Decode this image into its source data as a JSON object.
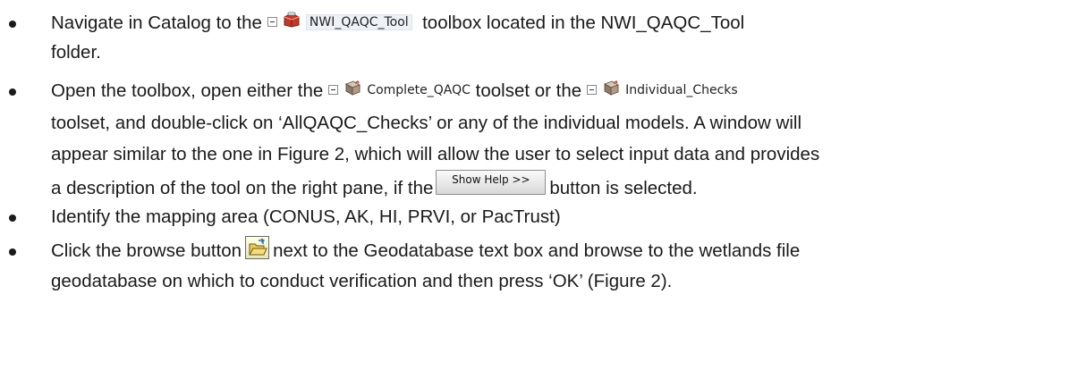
{
  "bullets": [
    {
      "line1": {
        "pre": "Navigate in Catalog to the",
        "icon": "toolbox-icon",
        "tool_label": "NWI_QAQC_Tool",
        "post": "toolbox located in the NWI_QAQC_Tool"
      },
      "line2": "folder."
    },
    {
      "line1": {
        "pre": "Open the toolbox, open either the",
        "icon1": "toolset-icon",
        "toolset1": "Complete_QAQC",
        "mid": "toolset or the",
        "icon2": "toolset-icon",
        "toolset2": "Individual_Checks"
      },
      "line2": "toolset, and double-click on ‘AllQAQC_Checks’ or any of the individual models. A window will",
      "line3": "appear similar to the one in Figure 2, which will allow the user to select input data and provides",
      "line4": {
        "pre": "a description of the tool on the right pane, if the",
        "button_label": "Show Help >>",
        "post": "button is selected."
      }
    },
    {
      "line1": "Identify the mapping area (CONUS, AK, HI, PRVI, or PacTrust)"
    },
    {
      "line1": {
        "pre": "Click the browse button",
        "icon": "open-folder-icon",
        "post": "next to the Geodatabase text box and browse to the wetlands file"
      },
      "line2": "geodatabase on which to conduct verification and then press ‘OK’ (Figure 2)."
    }
  ],
  "colors": {
    "text": "#1a1a1a",
    "toolbox_red": "#c0392b",
    "toolset_gray": "#8d7a6a"
  }
}
